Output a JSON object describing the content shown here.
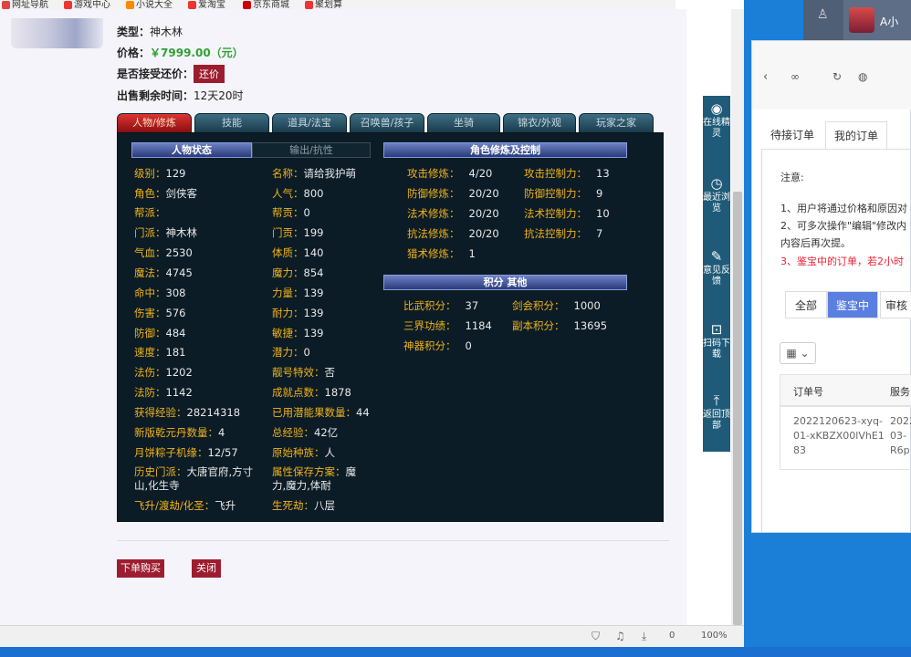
{
  "bookmarks": [
    "网址导航",
    "游戏中心",
    "小说大全",
    "爱淘宝",
    "京东商城",
    "聚划算"
  ],
  "item": {
    "type_label": "类型：",
    "type_value": "神木林",
    "price_label": "价格：",
    "price_value": "￥7999.00（元）",
    "bargain_label": "是否接受还价：",
    "bargain_btn": "还价",
    "time_label": "出售剩余时间：",
    "time_value": "12天20时"
  },
  "tabs": [
    "人物/修炼",
    "技能",
    "道具/法宝",
    "召唤兽/孩子",
    "坐骑",
    "锦衣/外观",
    "玩家之家"
  ],
  "panel": {
    "sub_tabs": [
      "人物状态",
      "输出/抗性"
    ],
    "left_col": [
      [
        "级别：",
        "129"
      ],
      [
        "角色：",
        "剑侠客"
      ],
      [
        "帮派：",
        ""
      ],
      [
        "门派：",
        "神木林"
      ],
      [
        "气血：",
        "2530"
      ],
      [
        "魔法：",
        "4745"
      ],
      [
        "命中：",
        "308"
      ],
      [
        "伤害：",
        "576"
      ],
      [
        "防御：",
        "484"
      ],
      [
        "速度：",
        "181"
      ],
      [
        "法伤：",
        "1202"
      ],
      [
        "法防：",
        "1142"
      ],
      [
        "获得经验：",
        "28214318"
      ],
      [
        "新版乾元丹数量：",
        "4"
      ],
      [
        "月饼粽子机缘：",
        "12/57"
      ],
      [
        "历史门派：",
        "大唐官府,方寸"
      ],
      [
        "",
        "山,化生寺"
      ],
      [
        "飞升/渡劫/化圣：",
        "飞升"
      ]
    ],
    "mid_col": [
      [
        "名称：",
        "请给我护萌"
      ],
      [
        "人气：",
        "800"
      ],
      [
        "帮贡：",
        "0"
      ],
      [
        "门贡：",
        "199"
      ],
      [
        "体质：",
        "140"
      ],
      [
        "魔力：",
        "854"
      ],
      [
        "力量：",
        "139"
      ],
      [
        "耐力：",
        "139"
      ],
      [
        "敏捷：",
        "139"
      ],
      [
        "潜力：",
        "0"
      ],
      [
        "靓号特效：",
        "否"
      ],
      [
        "成就点数：",
        "1878"
      ],
      [
        "已用潜能果数量：",
        "44"
      ],
      [
        "总经验：",
        "42亿"
      ],
      [
        "原始种族：",
        "人"
      ],
      [
        "属性保存方案：",
        "魔"
      ],
      [
        "",
        "力,魔力,体耐"
      ],
      [
        "生死劫：",
        "八层"
      ]
    ],
    "xiulian_title": "角色修炼及控制",
    "xiulian": [
      [
        "攻击修炼：",
        "4/20",
        "攻击控制力：",
        "13"
      ],
      [
        "防御修炼：",
        "20/20",
        "防御控制力：",
        "9"
      ],
      [
        "法术修炼：",
        "20/20",
        "法术控制力：",
        "10"
      ],
      [
        "抗法修炼：",
        "20/20",
        "抗法控制力：",
        "7"
      ],
      [
        "猎术修炼：",
        "1",
        "",
        ""
      ]
    ],
    "jifen_title": "积分 其他",
    "jifen": [
      [
        "比武积分：",
        "37",
        "剑会积分：",
        "1000"
      ],
      [
        "三界功绩：",
        "1184",
        "副本积分：",
        "13695"
      ],
      [
        "神器积分：",
        "0",
        "",
        ""
      ]
    ]
  },
  "buttons": {
    "buy": "下单购买",
    "close": "关闭"
  },
  "sidebar": [
    {
      "icon": "◉",
      "label": "在线精灵"
    },
    {
      "icon": "◷",
      "label": "最近浏览"
    },
    {
      "icon": "✎",
      "label": "意见反馈"
    },
    {
      "icon": "⊡",
      "label": "扫码下载"
    },
    {
      "icon": "⤒",
      "label": "返回顶部"
    }
  ],
  "status": {
    "zoom": "100%",
    "count": "0"
  },
  "popup": {
    "tabs": [
      "待接订单",
      "我的订单"
    ],
    "note_title": "注意:",
    "notes": [
      "1、用户将通过价格和原因对",
      "2、可多次操作\"编辑\"修改内",
      "内容后再次提。",
      "3、鉴宝中的订单，若2小时"
    ],
    "filters": [
      "全部",
      "鉴宝中",
      "审核"
    ],
    "col1": "订单号",
    "col2": "服务",
    "order_id": "2022120623-xyq-01-xKBZX00lVhE183",
    "order_date": "2022 03- R6p"
  },
  "user": {
    "name": "A小"
  },
  "colors": {
    "accent": "#9c1d2f",
    "label": "#f2b21a",
    "panel": "#0b1c26",
    "sidebar": "#1f5b78",
    "filter_active": "#5b7fe0"
  }
}
